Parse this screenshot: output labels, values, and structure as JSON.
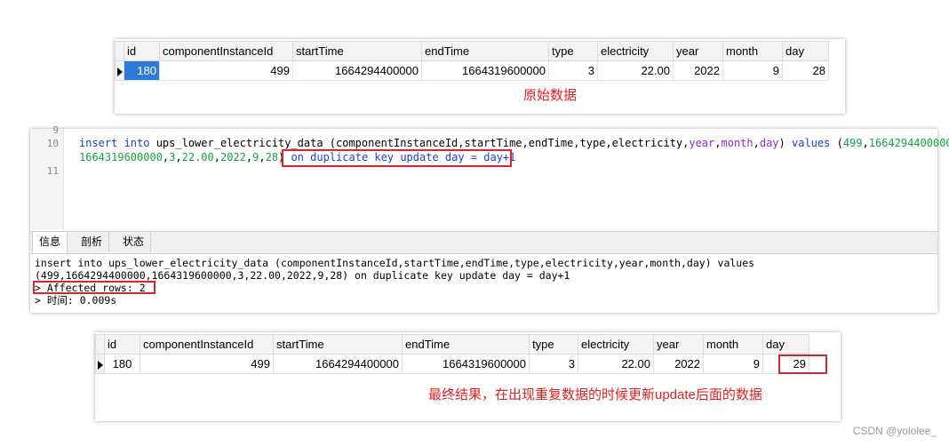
{
  "table_before": {
    "columns": [
      "id",
      "componentInstanceId",
      "startTime",
      "endTime",
      "type",
      "electricity",
      "year",
      "month",
      "day"
    ],
    "row": [
      "180",
      "499",
      "1664294400000",
      "1664319600000",
      "3",
      "22.00",
      "2022",
      "9",
      "28"
    ],
    "caption": "原始数据"
  },
  "editor": {
    "line_numbers": [
      "9",
      "10",
      "11"
    ],
    "sql": {
      "p1": "insert into",
      "p2": " ups_lower_electricity_data (componentInstanceId,startTime,endTime,type,electricity,",
      "p3": "year",
      "p4": ",",
      "p5": "month",
      "p6": ",",
      "p7": "day",
      "p8": ") ",
      "p9": "values",
      "p10": " (",
      "p11": "499",
      "p12": ",",
      "p13": "1664294400000",
      "p14": ",",
      "l2a": "1664319600000",
      "l2b": ",",
      "l2c": "3",
      "l2d": ",",
      "l2e": "22.00",
      "l2f": ",",
      "l2g": "2022",
      "l2h": ",",
      "l2i": "9",
      "l2j": ",",
      "l2k": "28",
      "l2l": ") ",
      "l2m": "on duplicate key update day = day+1"
    },
    "tabs": [
      "信息",
      "剖析",
      "状态"
    ],
    "output": {
      "line1": "insert into ups_lower_electricity_data (componentInstanceId,startTime,endTime,type,electricity,year,month,day) values",
      "line2": "(499,1664294400000,1664319600000,3,22.00,2022,9,28) on duplicate key update day = day+1",
      "line3": "> Affected rows: 2",
      "line4": "> 时间: 0.009s"
    }
  },
  "table_after": {
    "columns": [
      "id",
      "componentInstanceId",
      "startTime",
      "endTime",
      "type",
      "electricity",
      "year",
      "month",
      "day"
    ],
    "row": [
      "180",
      "499",
      "1664294400000",
      "1664319600000",
      "3",
      "22.00",
      "2022",
      "9",
      "29"
    ],
    "caption": "最终结果，在出现重复数据的时候更新update后面的数据"
  },
  "watermark": "CSDN @yololee_",
  "colors": {
    "highlight_red": "#d9262c",
    "caption_red": "#e02020",
    "selection_blue": "#2e7bd6"
  }
}
